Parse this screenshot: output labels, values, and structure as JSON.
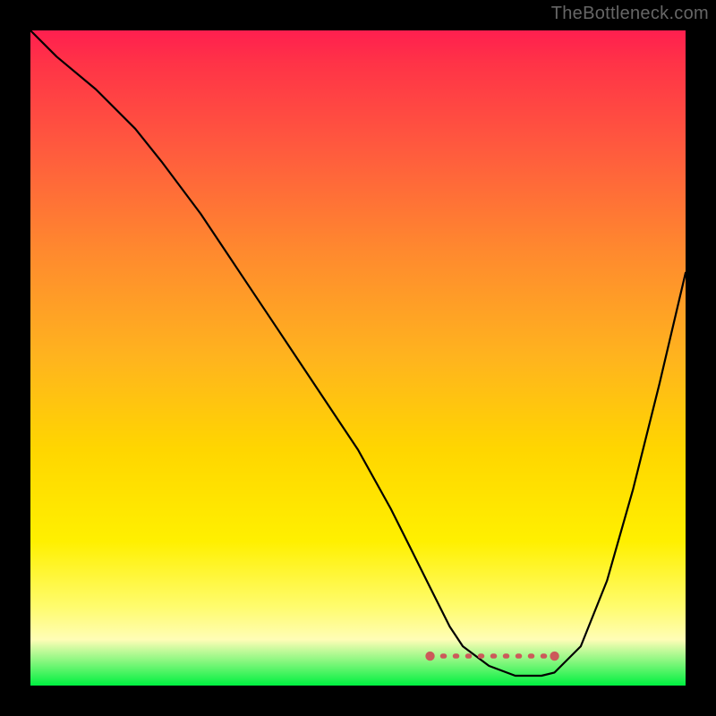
{
  "attribution": "TheBottleneck.com",
  "chart_data": {
    "type": "line",
    "title": "",
    "xlabel": "",
    "ylabel": "",
    "xlim": [
      0,
      100
    ],
    "ylim": [
      0,
      100
    ],
    "series": [
      {
        "name": "curve",
        "x": [
          0,
          4,
          10,
          16,
          20,
          26,
          32,
          38,
          44,
          50,
          55,
          58,
          61,
          64,
          66,
          70,
          74,
          78,
          80,
          84,
          88,
          92,
          96,
          100
        ],
        "y": [
          100,
          96,
          91,
          85,
          80,
          72,
          63,
          54,
          45,
          36,
          27,
          21,
          15,
          9,
          6,
          3,
          1.5,
          1.5,
          2,
          6,
          16,
          30,
          46,
          63
        ]
      }
    ],
    "marker_band": {
      "name": "optimal-range",
      "x_start": 61,
      "x_end": 80,
      "y": 4.5
    },
    "background": {
      "type": "vertical-gradient",
      "stops": [
        {
          "pos": 0.0,
          "color": "#ff1f4f"
        },
        {
          "pos": 0.18,
          "color": "#ff5a3e"
        },
        {
          "pos": 0.5,
          "color": "#ffb41e"
        },
        {
          "pos": 0.78,
          "color": "#fff000"
        },
        {
          "pos": 1.0,
          "color": "#00f040"
        }
      ]
    }
  }
}
